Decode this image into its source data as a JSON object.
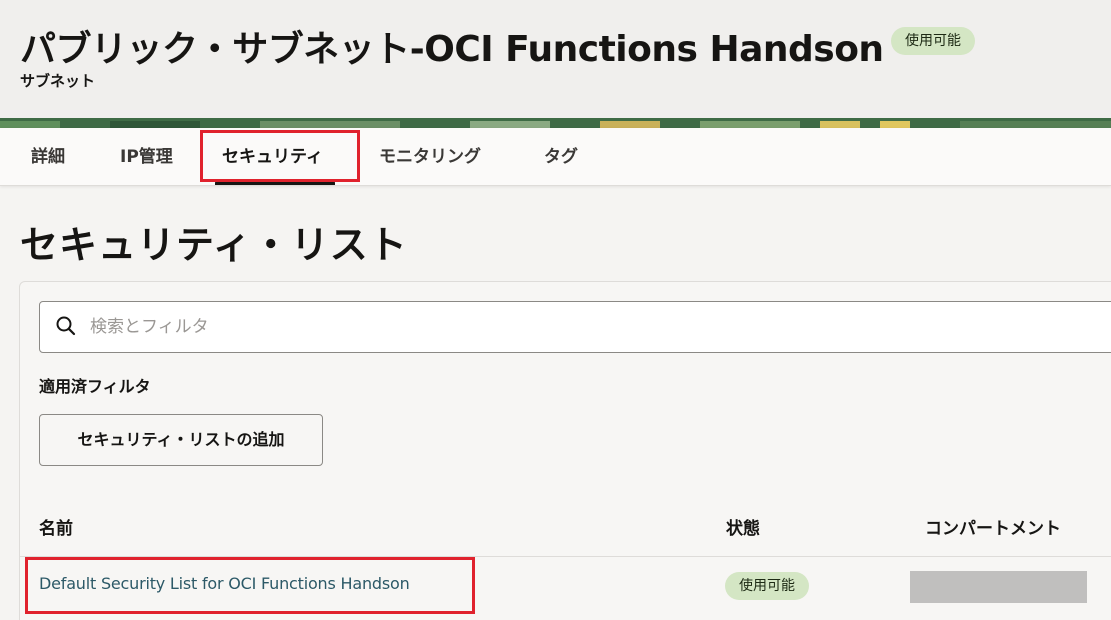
{
  "header": {
    "title": "パブリック・サブネット-OCI Functions Handson",
    "status_badge": "使用可能",
    "subtitle": "サブネット"
  },
  "tabs": [
    {
      "label": "詳細",
      "active": false
    },
    {
      "label": "IP管理",
      "active": false
    },
    {
      "label": "セキュリティ",
      "active": true
    },
    {
      "label": "モニタリング",
      "active": false
    },
    {
      "label": "タグ",
      "active": false
    }
  ],
  "section": {
    "title": "セキュリティ・リスト"
  },
  "search": {
    "placeholder": "検索とフィルタ",
    "value": "",
    "icon": "search-icon"
  },
  "filters": {
    "label": "適用済フィルタ"
  },
  "actions": {
    "add_label": "セキュリティ・リストの追加"
  },
  "table": {
    "columns": [
      "名前",
      "状態",
      "コンパートメント"
    ],
    "rows": [
      {
        "name": "Default Security List for OCI Functions Handson",
        "status": "使用可能",
        "compartment": ""
      }
    ]
  },
  "colors": {
    "badge_bg": "#d4e6c4",
    "highlight": "#e0222d",
    "link": "#2c5967"
  }
}
